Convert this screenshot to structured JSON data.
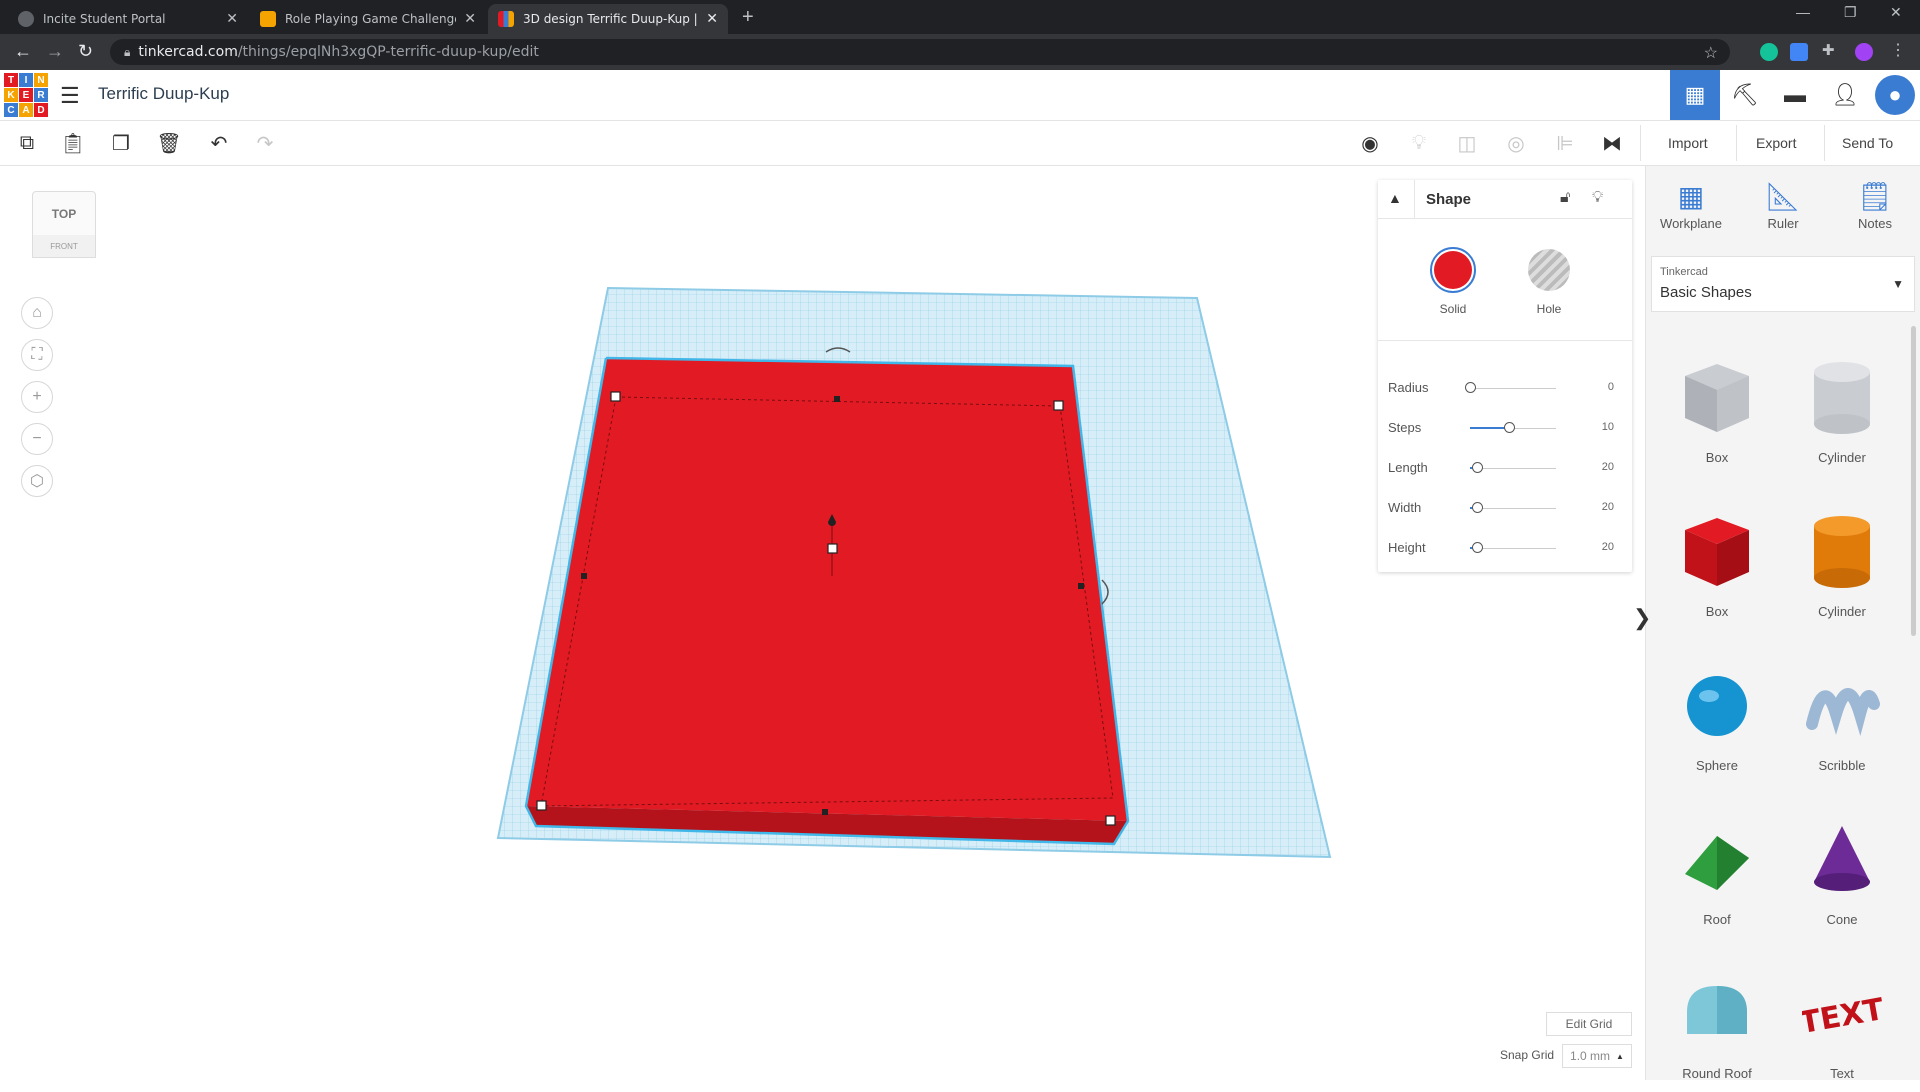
{
  "browser": {
    "tabs": [
      {
        "title": "Incite Student Portal",
        "active": false
      },
      {
        "title": "Role Playing Game Challenge - In",
        "active": false
      },
      {
        "title": "3D design Terrific Duup-Kup | Tin",
        "active": true
      }
    ],
    "url_host": "tinkercad.com",
    "url_path": "/things/epqlNh3xgQP-terrific-duup-kup/edit"
  },
  "app": {
    "logo_letters": [
      "T",
      "I",
      "N",
      "K",
      "E",
      "R",
      "C",
      "A",
      "D"
    ],
    "design_title": "Terrific Duup-Kup"
  },
  "toolbar": {
    "import_label": "Import",
    "export_label": "Export",
    "sendto_label": "Send To"
  },
  "viewcube": {
    "top_label": "TOP",
    "front_label": "FRONT"
  },
  "shape_panel": {
    "title": "Shape",
    "solid_label": "Solid",
    "hole_label": "Hole",
    "solid_color": "#e21a23",
    "properties": [
      {
        "label": "Radius",
        "value": "0",
        "fraction": 0.0
      },
      {
        "label": "Steps",
        "value": "10",
        "fraction": 0.45
      },
      {
        "label": "Length",
        "value": "20",
        "fraction": 0.08
      },
      {
        "label": "Width",
        "value": "20",
        "fraction": 0.08
      },
      {
        "label": "Height",
        "value": "20",
        "fraction": 0.08
      }
    ]
  },
  "sidebar": {
    "workplane_label": "Workplane",
    "ruler_label": "Ruler",
    "notes_label": "Notes",
    "library_vendor": "Tinkercad",
    "library_name": "Basic Shapes",
    "shapes": [
      {
        "name": "Box",
        "kind": "box-hole"
      },
      {
        "name": "Cylinder",
        "kind": "cyl-hole"
      },
      {
        "name": "Box",
        "kind": "box-red"
      },
      {
        "name": "Cylinder",
        "kind": "cyl-orange"
      },
      {
        "name": "Sphere",
        "kind": "sphere"
      },
      {
        "name": "Scribble",
        "kind": "scribble"
      },
      {
        "name": "Roof",
        "kind": "roof"
      },
      {
        "name": "Cone",
        "kind": "cone"
      },
      {
        "name": "Round Roof",
        "kind": "round-roof"
      },
      {
        "name": "Text",
        "kind": "text"
      }
    ]
  },
  "grid": {
    "edit_grid_label": "Edit Grid",
    "snap_grid_label": "Snap Grid",
    "snap_value": "1.0 mm"
  },
  "colors": {
    "accent": "#3b7cd3",
    "workplane": "#cfe9f6",
    "shape_red": "#e21a23"
  }
}
